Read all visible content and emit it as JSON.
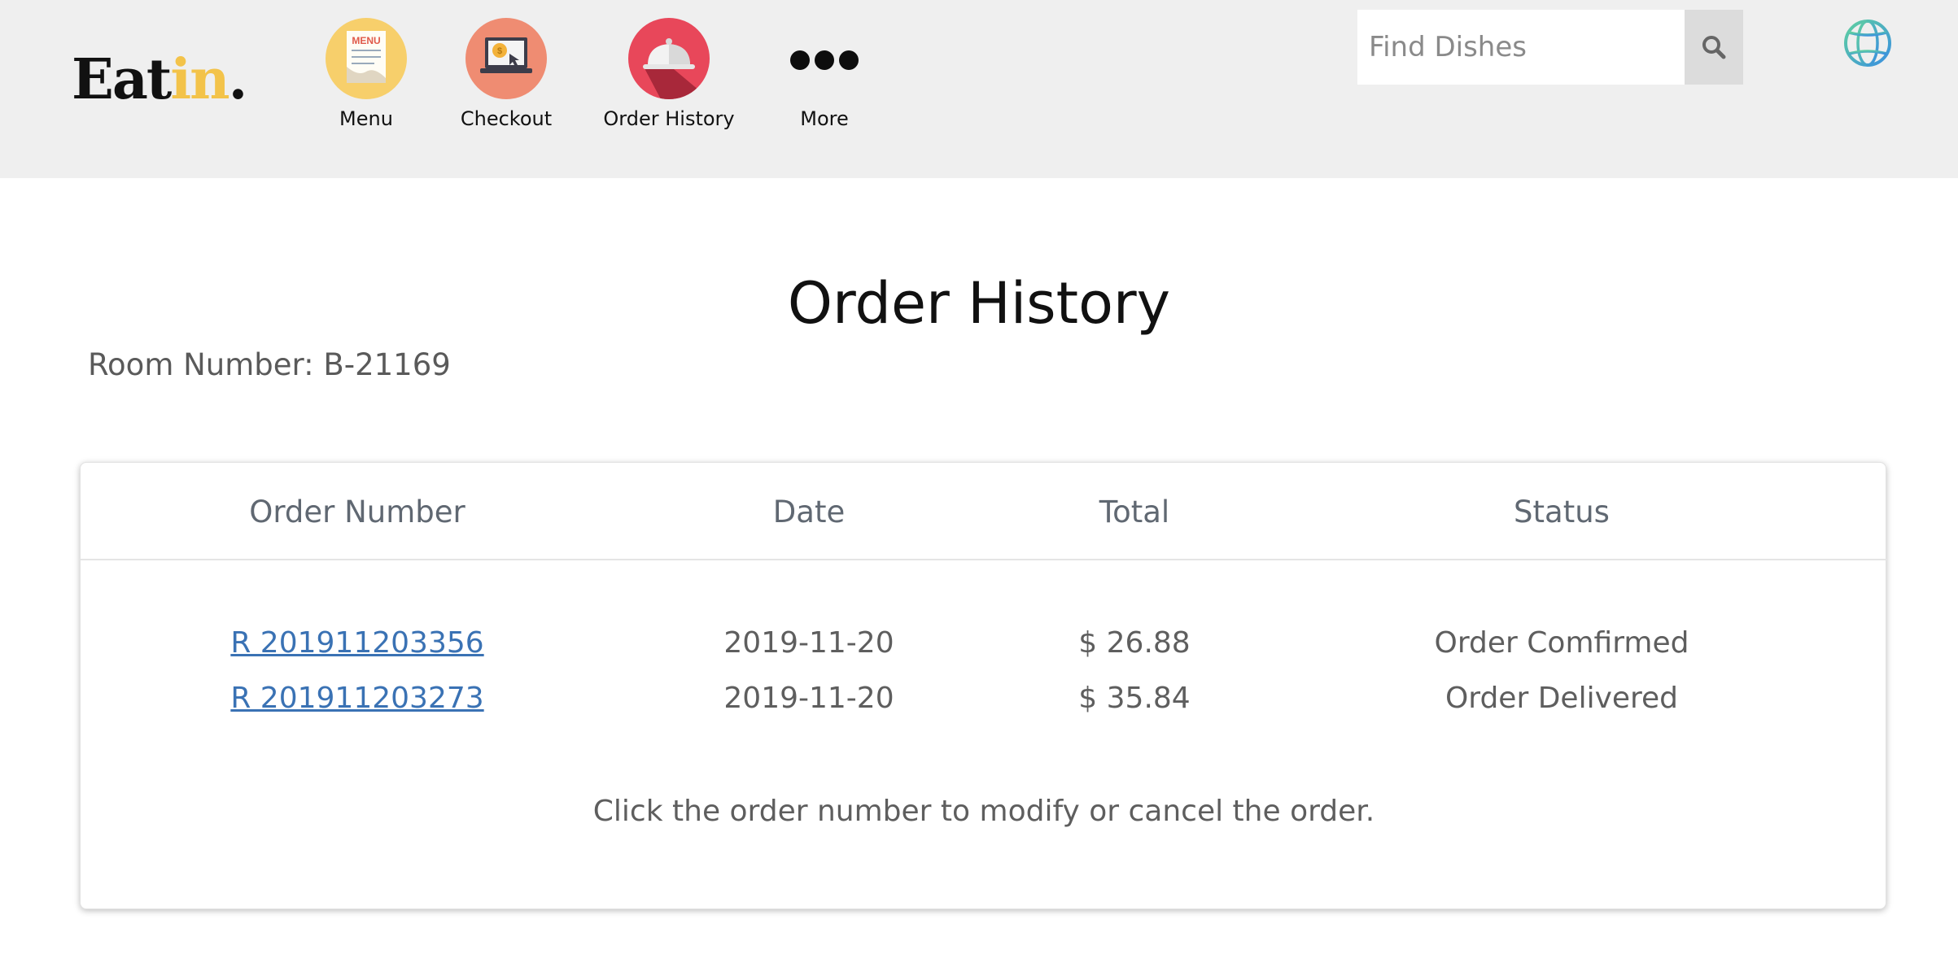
{
  "logo": {
    "main": "Eat",
    "accent": "in",
    "dot": "."
  },
  "nav": [
    {
      "label": "Menu",
      "icon": "menu-card-icon",
      "color": "#f7cf6b"
    },
    {
      "label": "Checkout",
      "icon": "laptop-payment-icon",
      "color": "#ef8c72"
    },
    {
      "label": "Order History",
      "icon": "food-cloche-icon",
      "color": "#e8475a"
    },
    {
      "label": "More",
      "icon": "more-dots-icon"
    }
  ],
  "menu_icon_text": "MENU",
  "search": {
    "placeholder": "Find Dishes",
    "value": ""
  },
  "page_title": "Order History",
  "room": {
    "label": "Room Number:",
    "value": "B-21169"
  },
  "table": {
    "headers": [
      "Order Number",
      "Date",
      "Total",
      "Status"
    ],
    "rows": [
      {
        "order": "R 201911203356",
        "date": "2019-11-20",
        "total": "$ 26.88",
        "status": "Order Comfirmed"
      },
      {
        "order": "R 201911203273",
        "date": "2019-11-20",
        "total": "$ 35.84",
        "status": "Order Delivered"
      }
    ],
    "note": "Click the order number to modify or cancel the order."
  },
  "colors": {
    "accent": "#f3c34a",
    "link": "#3a72b4",
    "header_bg": "#efefef"
  }
}
